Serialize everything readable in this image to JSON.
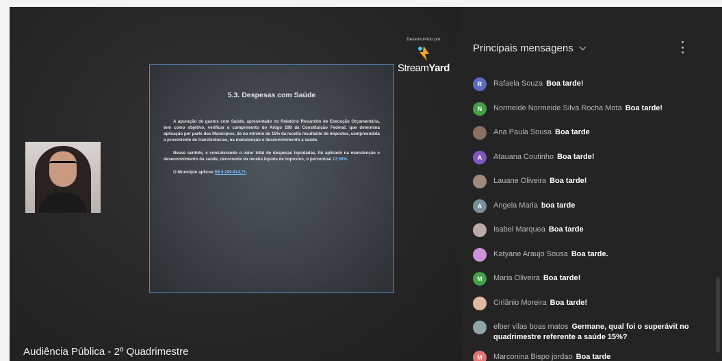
{
  "caption": "Audiência Pública - 2º Quadrimestre",
  "branding": {
    "dev_label": "Desenvolvido por",
    "logo_stream": "Stream",
    "logo_yard": "Yard"
  },
  "slide": {
    "title": "5.3. Despesas com Saúde",
    "p1": "A apuração de gastos com Saúde, apresentado no Relatório Resumido de Execução Orçamentária, tem como objetivo, verificar o cumprimento do Artigo 198 da Constituição Federal, que determina aplicação por parte dos Municípios, de no mínimo de 15% da receita resultante de impostos, compreendida a proveniente de transferências, na manutenção e desenvolvimento a saúde.",
    "p2_text": "Nesse sentido, e considerando o valor total de despesas liquidadas, foi aplicado na manutenção e desenvolvimento da saúde, decorrente da receita líquida de impostos, o percentual",
    "p2_value": "17,59%",
    "p3_text": "O Município aplicou",
    "p3_value": "R$ 6.299.614,71"
  },
  "chat": {
    "header": "Principais mensagens",
    "messages": [
      {
        "author": "Rafaela Souza",
        "text": "Boa tarde!",
        "initial": "R",
        "color": "#5c6bc0"
      },
      {
        "author": "Normeide Normeide Silva Rocha Mota",
        "text": "Boa tarde!",
        "initial": "N",
        "color": "#43a047"
      },
      {
        "author": "Ana Paula Sousa",
        "text": "Boa tarde",
        "initial": "",
        "color": "#8d6e63"
      },
      {
        "author": "Atauana Coutinho",
        "text": "Boa tarde!",
        "initial": "A",
        "color": "#7e57c2"
      },
      {
        "author": "Lauane Oliveira",
        "text": "Boa tarde!",
        "initial": "",
        "color": "#a1887f"
      },
      {
        "author": "Angela Maria",
        "text": "boa tarde",
        "initial": "A",
        "color": "#78909c"
      },
      {
        "author": "Isabel Marquea",
        "text": "Boa tarde",
        "initial": "",
        "color": "#bcaaa4"
      },
      {
        "author": "Katyane Araujo Sousa",
        "text": "Boa tarde.",
        "initial": "",
        "color": "#ce93d8"
      },
      {
        "author": "Maria Oliveira",
        "text": "Boa tarde!",
        "initial": "M",
        "color": "#43a047"
      },
      {
        "author": "Cirlânio Moreira",
        "text": "Boa tarde!",
        "initial": "",
        "color": "#e0b8a0"
      },
      {
        "author": "elber vilas boas matos",
        "text": "Germane, qual foi o superávit no quadrimestre referente a saúde 15%?",
        "initial": "",
        "color": "#90a4ae"
      },
      {
        "author": "Marconina Bispo jordao",
        "text": "Boa tarde",
        "initial": "M",
        "color": "#e57373"
      }
    ]
  }
}
